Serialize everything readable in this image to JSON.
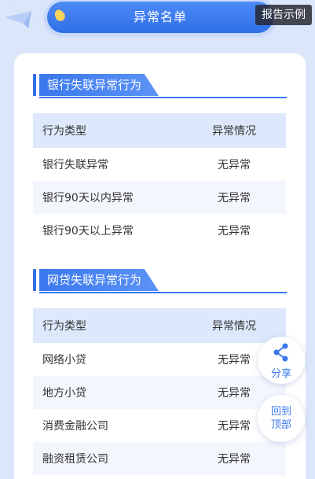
{
  "header": {
    "title": "异常名单",
    "report_button": "报告示例"
  },
  "sections": [
    {
      "title": "银行失联异常行为",
      "columns": [
        "行为类型",
        "异常情况"
      ],
      "rows": [
        [
          "银行失联异常",
          "无异常"
        ],
        [
          "银行90天以内异常",
          "无异常"
        ],
        [
          "银行90天以上异常",
          "无异常"
        ]
      ]
    },
    {
      "title": "网贷失联异常行为",
      "columns": [
        "行为类型",
        "异常情况"
      ],
      "rows": [
        [
          "网络小贷",
          "无异常"
        ],
        [
          "地方小贷",
          "无异常"
        ],
        [
          "消费金融公司",
          "无异常"
        ],
        [
          "融资租赁公司",
          "无异常"
        ]
      ]
    }
  ],
  "floating": {
    "share_label": "分享",
    "back_top_line1": "回到",
    "back_top_line2": "顶部"
  },
  "colors": {
    "accent": "#2f6fe8",
    "background": "#dbe6fb"
  }
}
